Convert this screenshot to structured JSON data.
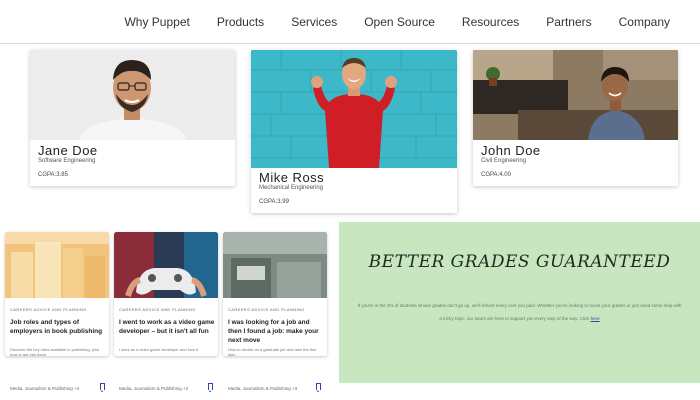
{
  "nav": {
    "links": [
      "Why Puppet",
      "Products",
      "Services",
      "Open Source",
      "Resources",
      "Partners",
      "Company"
    ]
  },
  "profiles": [
    {
      "name": "Jane Doe",
      "field": "Software Engineering",
      "cgpa": "CGPA:3.85"
    },
    {
      "name": "Mike Ross",
      "field": "Mechanical Engineering",
      "cgpa": "CGPA:3.99"
    },
    {
      "name": "John Doe",
      "field": "Civil Engineering",
      "cgpa": "CGPA:4.00"
    }
  ],
  "blogs": [
    {
      "category": "CAREERS ADVICE AND PLANNING",
      "title": "Job roles and types of employers in book publishing",
      "excerpt": "Discover the key roles available in publishing, plus how to get into them",
      "meta": "Media, Journalism & Publishing +3"
    },
    {
      "category": "CAREERS ADVICE AND PLANNING",
      "title": "I went to work as a video game developer – but it isn't all fun",
      "excerpt": "I work as a video game developer and love it",
      "meta": "Media, Journalism & Publishing +2"
    },
    {
      "category": "CAREERS ADVICE AND PLANNING",
      "title": "I was looking for a job and then I found a job: make your next move",
      "excerpt": "How to decide on a graduate job and take the first step",
      "meta": "Media, Journalism & Publishing +3"
    }
  ],
  "promo": {
    "headline": "BETTER GRADES GUARANTEED",
    "body": "If you're in the 2% of students whose grades don't go up, we'll refund every cent you paid. Whether you're looking to boost your grades or just need some help with a tricky topic, our tutors are here to support you every step of the way. Click",
    "link": "here"
  },
  "colors": {
    "promo_bg": "#c8e6c0",
    "bookmark": "#3344aa"
  }
}
